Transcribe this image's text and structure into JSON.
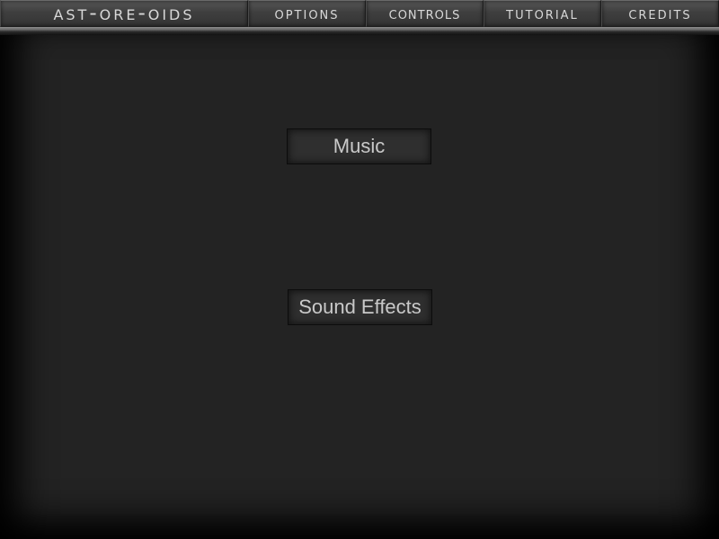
{
  "topbar": {
    "title": "Ast-Ore-Oids",
    "tabs": [
      {
        "label": "Options"
      },
      {
        "label": "Controls"
      },
      {
        "label": "Tutorial"
      },
      {
        "label": "Credits"
      }
    ]
  },
  "options_panel": {
    "music_label": "Music",
    "sound_effects_label": "Sound Effects"
  },
  "colors": {
    "background": "#232323",
    "tab_text": "#d8d8d8",
    "button_text": "#c9c9c9"
  }
}
